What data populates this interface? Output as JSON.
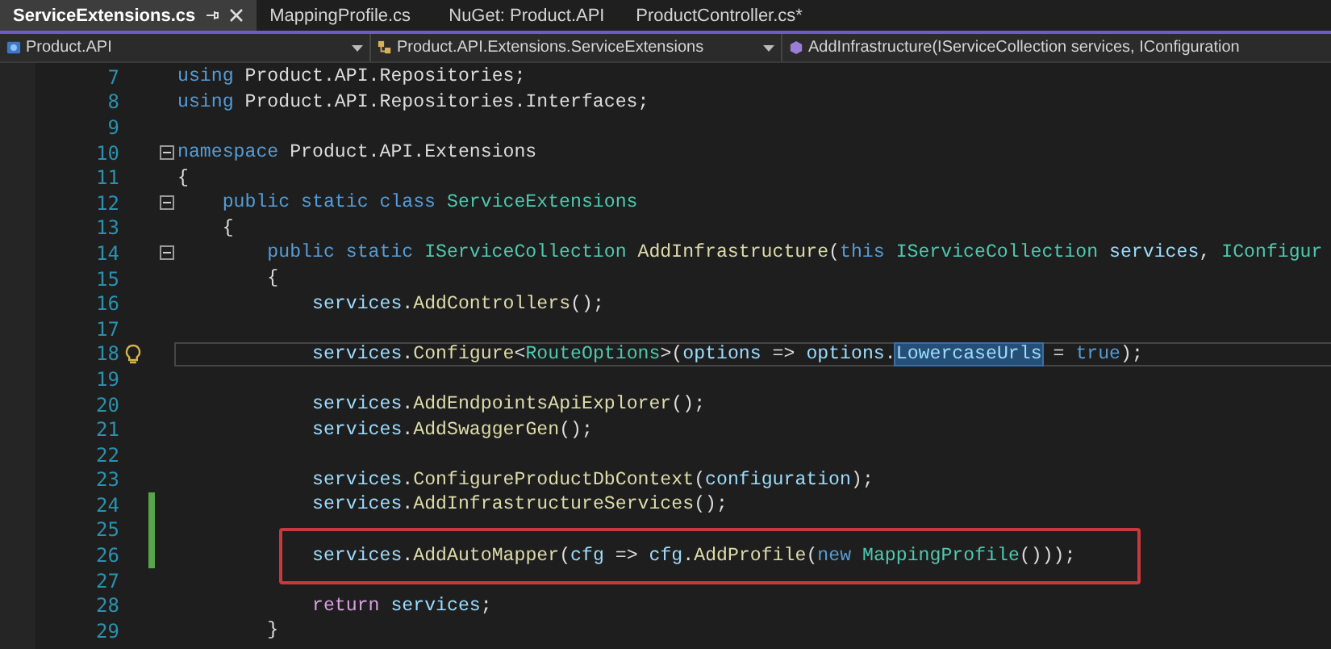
{
  "tabs": [
    {
      "label": "ServiceExtensions.cs",
      "selected": true
    },
    {
      "label": "MappingProfile.cs",
      "selected": false
    },
    {
      "label": "NuGet: Product.API",
      "selected": false
    },
    {
      "label": "ProductController.cs*",
      "selected": false
    }
  ],
  "navigation_bar": [
    {
      "kind": "project",
      "label": "Product.API"
    },
    {
      "kind": "class",
      "label": "Product.API.Extensions.ServiceExtensions"
    },
    {
      "kind": "method",
      "label": "AddInfrastructure(IServiceCollection services, IConfiguration"
    }
  ],
  "editor": {
    "lines": [
      {
        "number": "7",
        "fold": false,
        "changed": false,
        "current": false,
        "lightbulb": false,
        "boxed": false,
        "tokens": [
          {
            "kind": "keyword",
            "text": "using"
          },
          {
            "kind": "plain",
            "text": " Product.API.Repositories;"
          }
        ]
      },
      {
        "number": "8",
        "fold": false,
        "changed": false,
        "current": false,
        "lightbulb": false,
        "boxed": false,
        "tokens": [
          {
            "kind": "keyword",
            "text": "using"
          },
          {
            "kind": "plain",
            "text": " Product.API.Repositories.Interfaces;"
          }
        ]
      },
      {
        "number": "9",
        "fold": false,
        "changed": false,
        "current": false,
        "lightbulb": false,
        "boxed": false
      },
      {
        "number": "10",
        "fold": true,
        "changed": false,
        "current": false,
        "lightbulb": false,
        "boxed": false,
        "tokens": [
          {
            "kind": "keyword",
            "text": "namespace"
          },
          {
            "kind": "plain",
            "text": " Product.API.Extensions"
          }
        ]
      },
      {
        "number": "11",
        "fold": false,
        "changed": false,
        "current": false,
        "lightbulb": false,
        "boxed": false,
        "tokens": [
          {
            "kind": "plain",
            "text": "{"
          }
        ]
      },
      {
        "number": "12",
        "fold": true,
        "changed": false,
        "current": false,
        "lightbulb": false,
        "boxed": false,
        "tokens": [
          {
            "kind": "keyword",
            "text": "    public static class "
          },
          {
            "kind": "type",
            "text": "ServiceExtensions"
          }
        ]
      },
      {
        "number": "13",
        "fold": false,
        "changed": false,
        "current": false,
        "lightbulb": false,
        "boxed": false,
        "tokens": [
          {
            "kind": "plain",
            "text": "    {"
          }
        ]
      },
      {
        "number": "14",
        "fold": true,
        "changed": false,
        "current": false,
        "lightbulb": false,
        "boxed": false,
        "tokens": [
          {
            "kind": "keyword",
            "text": "        public static "
          },
          {
            "kind": "type",
            "text": "IServiceCollection "
          },
          {
            "kind": "method",
            "text": "AddInfrastructure"
          },
          {
            "kind": "plain",
            "text": "("
          },
          {
            "kind": "keyword",
            "text": "this "
          },
          {
            "kind": "type",
            "text": "IServiceCollection "
          },
          {
            "kind": "variable",
            "text": "services"
          },
          {
            "kind": "plain",
            "text": ", "
          },
          {
            "kind": "type",
            "text": "IConfigur"
          }
        ]
      },
      {
        "number": "15",
        "fold": false,
        "changed": false,
        "current": false,
        "lightbulb": false,
        "boxed": false,
        "tokens": [
          {
            "kind": "plain",
            "text": "        {"
          }
        ]
      },
      {
        "number": "16",
        "fold": false,
        "changed": false,
        "current": false,
        "lightbulb": false,
        "boxed": false,
        "tokens": [
          {
            "kind": "variable",
            "text": "            services"
          },
          {
            "kind": "plain",
            "text": "."
          },
          {
            "kind": "method",
            "text": "AddControllers"
          },
          {
            "kind": "plain",
            "text": "();"
          }
        ]
      },
      {
        "number": "17",
        "fold": false,
        "changed": false,
        "current": false,
        "lightbulb": false,
        "boxed": false
      },
      {
        "number": "18",
        "fold": false,
        "changed": false,
        "current": true,
        "lightbulb": true,
        "boxed": false,
        "tokens": [
          {
            "kind": "variable",
            "text": "            services"
          },
          {
            "kind": "plain",
            "text": "."
          },
          {
            "kind": "method",
            "text": "Configure"
          },
          {
            "kind": "plain",
            "text": "<"
          },
          {
            "kind": "type",
            "text": "RouteOptions"
          },
          {
            "kind": "plain",
            "text": ">("
          },
          {
            "kind": "variable",
            "text": "options"
          },
          {
            "kind": "plain",
            "text": " => "
          },
          {
            "kind": "variable",
            "text": "options"
          },
          {
            "kind": "plain",
            "text": "."
          },
          {
            "kind": "highlight",
            "text": "LowercaseUrls"
          },
          {
            "kind": "plain",
            "text": " = "
          },
          {
            "kind": "keyword",
            "text": "true"
          },
          {
            "kind": "plain",
            "text": ");"
          }
        ]
      },
      {
        "number": "19",
        "fold": false,
        "changed": false,
        "current": false,
        "lightbulb": false,
        "boxed": false
      },
      {
        "number": "20",
        "fold": false,
        "changed": false,
        "current": false,
        "lightbulb": false,
        "boxed": false,
        "tokens": [
          {
            "kind": "variable",
            "text": "            services"
          },
          {
            "kind": "plain",
            "text": "."
          },
          {
            "kind": "method",
            "text": "AddEndpointsApiExplorer"
          },
          {
            "kind": "plain",
            "text": "();"
          }
        ]
      },
      {
        "number": "21",
        "fold": false,
        "changed": false,
        "current": false,
        "lightbulb": false,
        "boxed": false,
        "tokens": [
          {
            "kind": "variable",
            "text": "            services"
          },
          {
            "kind": "plain",
            "text": "."
          },
          {
            "kind": "method",
            "text": "AddSwaggerGen"
          },
          {
            "kind": "plain",
            "text": "();"
          }
        ]
      },
      {
        "number": "22",
        "fold": false,
        "changed": false,
        "current": false,
        "lightbulb": false,
        "boxed": false
      },
      {
        "number": "23",
        "fold": false,
        "changed": false,
        "current": false,
        "lightbulb": false,
        "boxed": false,
        "tokens": [
          {
            "kind": "variable",
            "text": "            services"
          },
          {
            "kind": "plain",
            "text": "."
          },
          {
            "kind": "method",
            "text": "ConfigureProductDbContext"
          },
          {
            "kind": "plain",
            "text": "("
          },
          {
            "kind": "variable",
            "text": "configuration"
          },
          {
            "kind": "plain",
            "text": ");"
          }
        ]
      },
      {
        "number": "24",
        "fold": false,
        "changed": true,
        "current": false,
        "lightbulb": false,
        "boxed": false,
        "tokens": [
          {
            "kind": "variable",
            "text": "            services"
          },
          {
            "kind": "plain",
            "text": "."
          },
          {
            "kind": "method",
            "text": "AddInfrastructureServices"
          },
          {
            "kind": "plain",
            "text": "();"
          }
        ]
      },
      {
        "number": "25",
        "fold": false,
        "changed": true,
        "current": false,
        "lightbulb": false,
        "boxed": false
      },
      {
        "number": "26",
        "fold": false,
        "changed": true,
        "current": false,
        "lightbulb": false,
        "boxed": true,
        "tokens": [
          {
            "kind": "variable",
            "text": "            services"
          },
          {
            "kind": "plain",
            "text": "."
          },
          {
            "kind": "method",
            "text": "AddAutoMapper"
          },
          {
            "kind": "plain",
            "text": "("
          },
          {
            "kind": "variable",
            "text": "cfg"
          },
          {
            "kind": "plain",
            "text": " => "
          },
          {
            "kind": "variable",
            "text": "cfg"
          },
          {
            "kind": "plain",
            "text": "."
          },
          {
            "kind": "method",
            "text": "AddProfile"
          },
          {
            "kind": "plain",
            "text": "("
          },
          {
            "kind": "keyword",
            "text": "new "
          },
          {
            "kind": "type",
            "text": "MappingProfile"
          },
          {
            "kind": "plain",
            "text": "()));"
          }
        ]
      },
      {
        "number": "27",
        "fold": false,
        "changed": false,
        "current": false,
        "lightbulb": false,
        "boxed": false
      },
      {
        "number": "28",
        "fold": false,
        "changed": false,
        "current": false,
        "lightbulb": false,
        "boxed": false,
        "tokens": [
          {
            "kind": "control",
            "text": "            return "
          },
          {
            "kind": "variable",
            "text": "services"
          },
          {
            "kind": "plain",
            "text": ";"
          }
        ]
      },
      {
        "number": "29",
        "fold": false,
        "changed": false,
        "current": false,
        "lightbulb": false,
        "boxed": false,
        "tokens": [
          {
            "kind": "plain",
            "text": "        }"
          }
        ]
      }
    ]
  }
}
